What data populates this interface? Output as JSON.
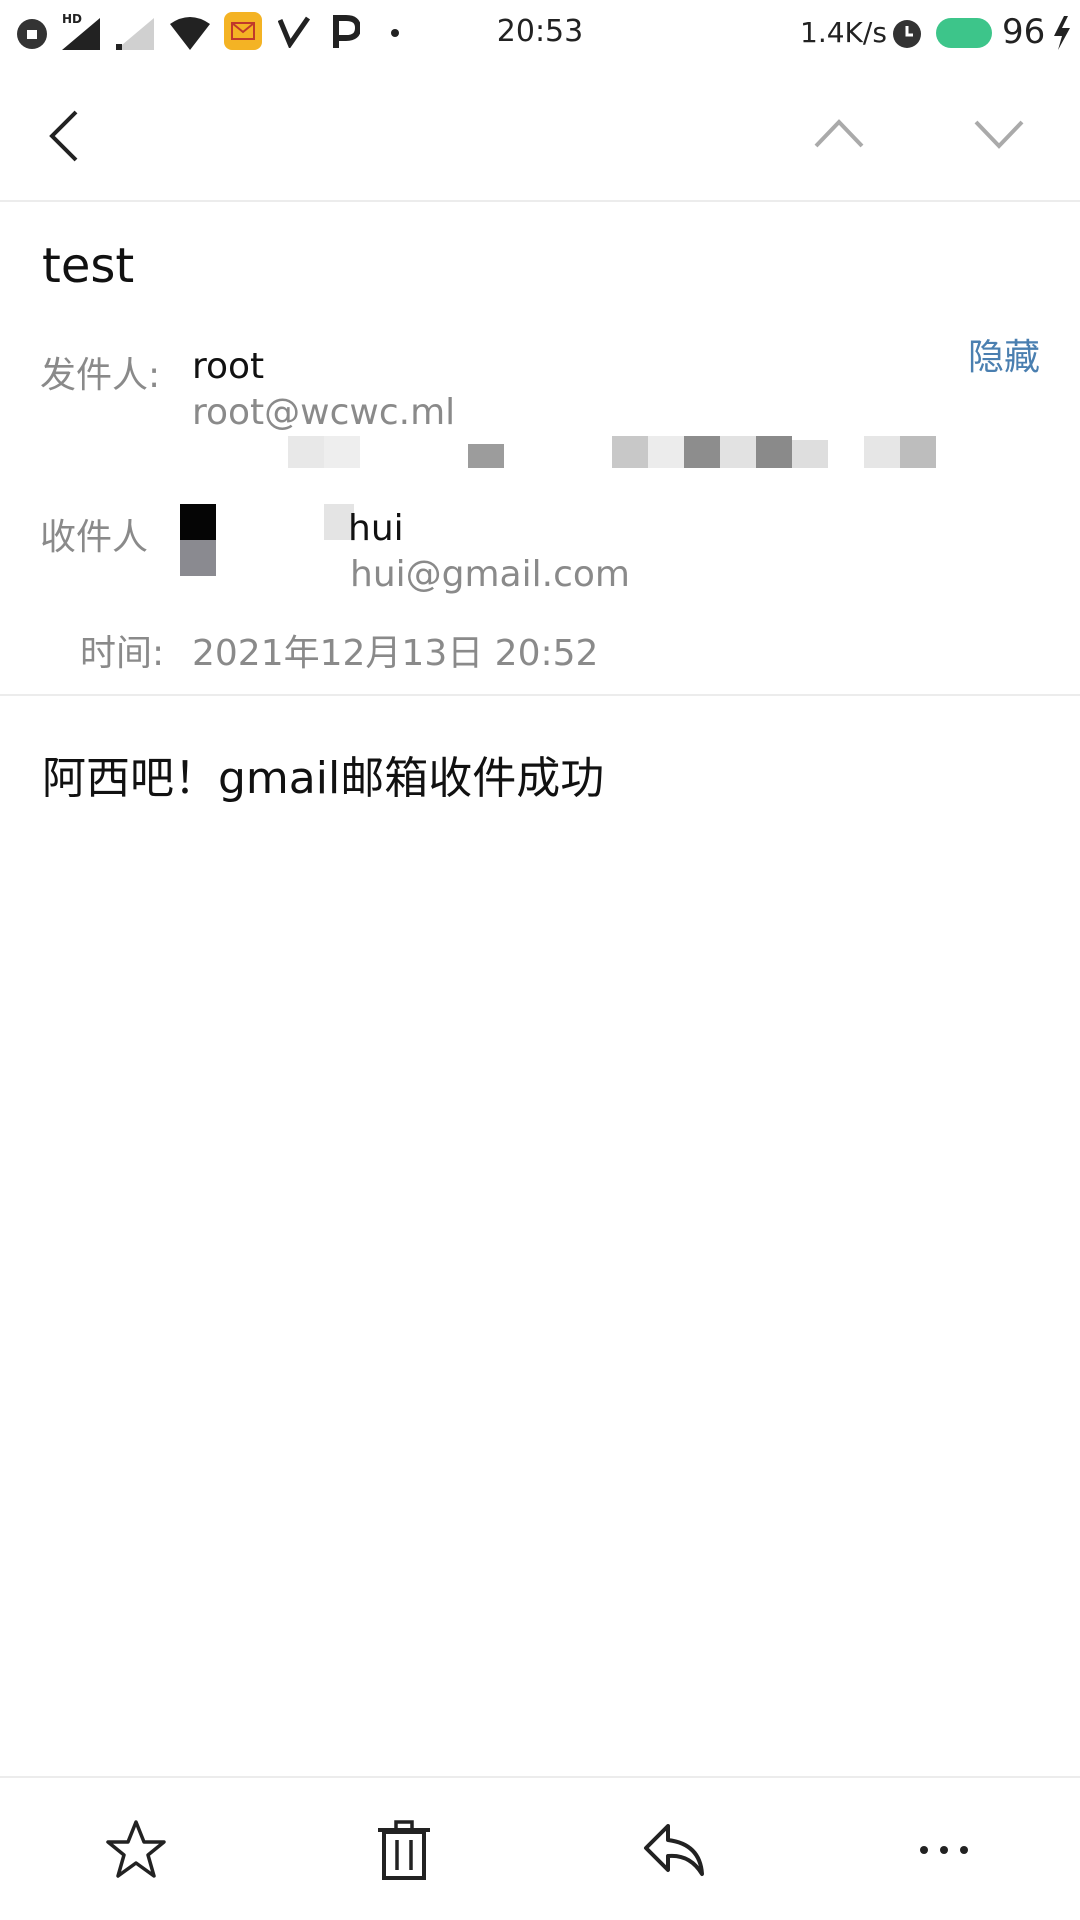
{
  "status_bar": {
    "time": "20:53",
    "net_speed": "1.4K/s",
    "battery_level": "96",
    "hd_badge": "HD",
    "icons": [
      "vpn-icon",
      "signal-icon",
      "signal-icon",
      "wifi-icon",
      "mail-notification-icon",
      "v-app-icon",
      "p-app-icon",
      "dot-icon",
      "alarm-icon",
      "battery-icon",
      "charging-icon"
    ],
    "accent_battery": "#3dc58a"
  },
  "nav": {
    "icons": [
      "back-chevron-icon",
      "up-chevron-icon",
      "down-chevron-icon"
    ]
  },
  "mail": {
    "subject": "test",
    "hide_label": "隐藏",
    "from_label": "发件人:",
    "from_name": "root",
    "from_email": "root@wcwc.ml",
    "to_label": "收件人",
    "to_name": "hui",
    "to_email": "hui@gmail.com",
    "time_label": "时间:",
    "time_value": "2021年12月13日 20:52",
    "body": "阿西吧！gmail邮箱收件成功",
    "link_color": "#4a7fb0"
  },
  "toolbar": {
    "icons": [
      "star-icon",
      "trash-icon",
      "reply-icon",
      "more-icon"
    ]
  }
}
